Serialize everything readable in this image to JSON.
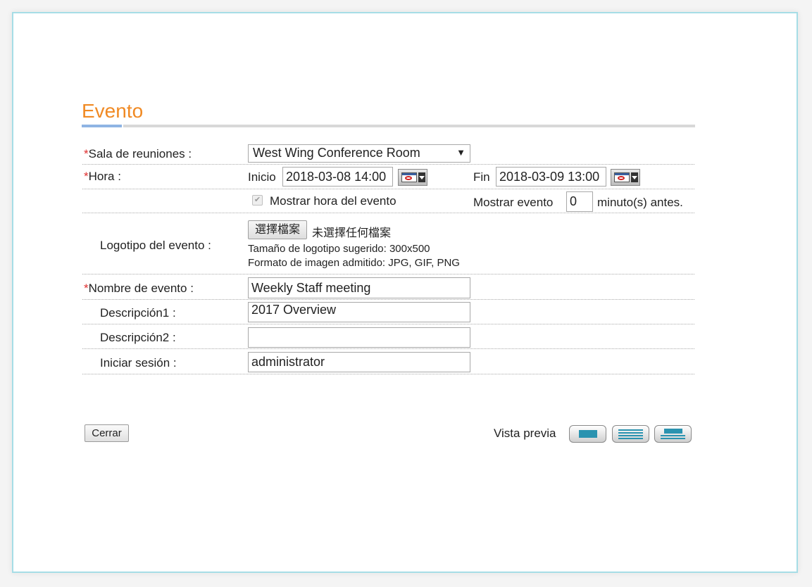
{
  "title": "Evento",
  "required_mark": "*",
  "fields": {
    "room": {
      "label": "Sala de reuniones :",
      "value": "West Wing Conference Room",
      "arrow": "▼"
    },
    "time": {
      "label": "Hora :",
      "start_label": "Inicio",
      "start_value": "2018-03-08 14:00",
      "end_label": "Fin",
      "end_value": "2018-03-09 13:00"
    },
    "display": {
      "show_time_label": "Mostrar hora del evento",
      "show_time_checked": true,
      "show_before_label": "Mostrar evento",
      "show_before_value": "0",
      "show_before_suffix": "minuto(s) antes."
    },
    "logo": {
      "label": "Logotipo del evento :",
      "choose_button": "選擇檔案",
      "no_file_text": "未選擇任何檔案",
      "hint_size": "Tamaño de logotipo sugerido: 300x500",
      "hint_format": "Formato de imagen admitido: JPG, GIF, PNG"
    },
    "name": {
      "label": "Nombre de evento :",
      "value": "Weekly Staff meeting"
    },
    "desc1": {
      "label": "Descripción1 :",
      "value": "2017 Overview"
    },
    "desc2": {
      "label": "Descripción2 :",
      "value": ""
    },
    "login": {
      "label": "Iniciar sesión :",
      "value": "administrator"
    }
  },
  "footer": {
    "close_button": "Cerrar",
    "preview_label": "Vista previa"
  },
  "colors": {
    "title": "#f08a24",
    "accent_border": "#a6dde6",
    "preview_icon": "#2a93b0",
    "required": "#e03030"
  }
}
